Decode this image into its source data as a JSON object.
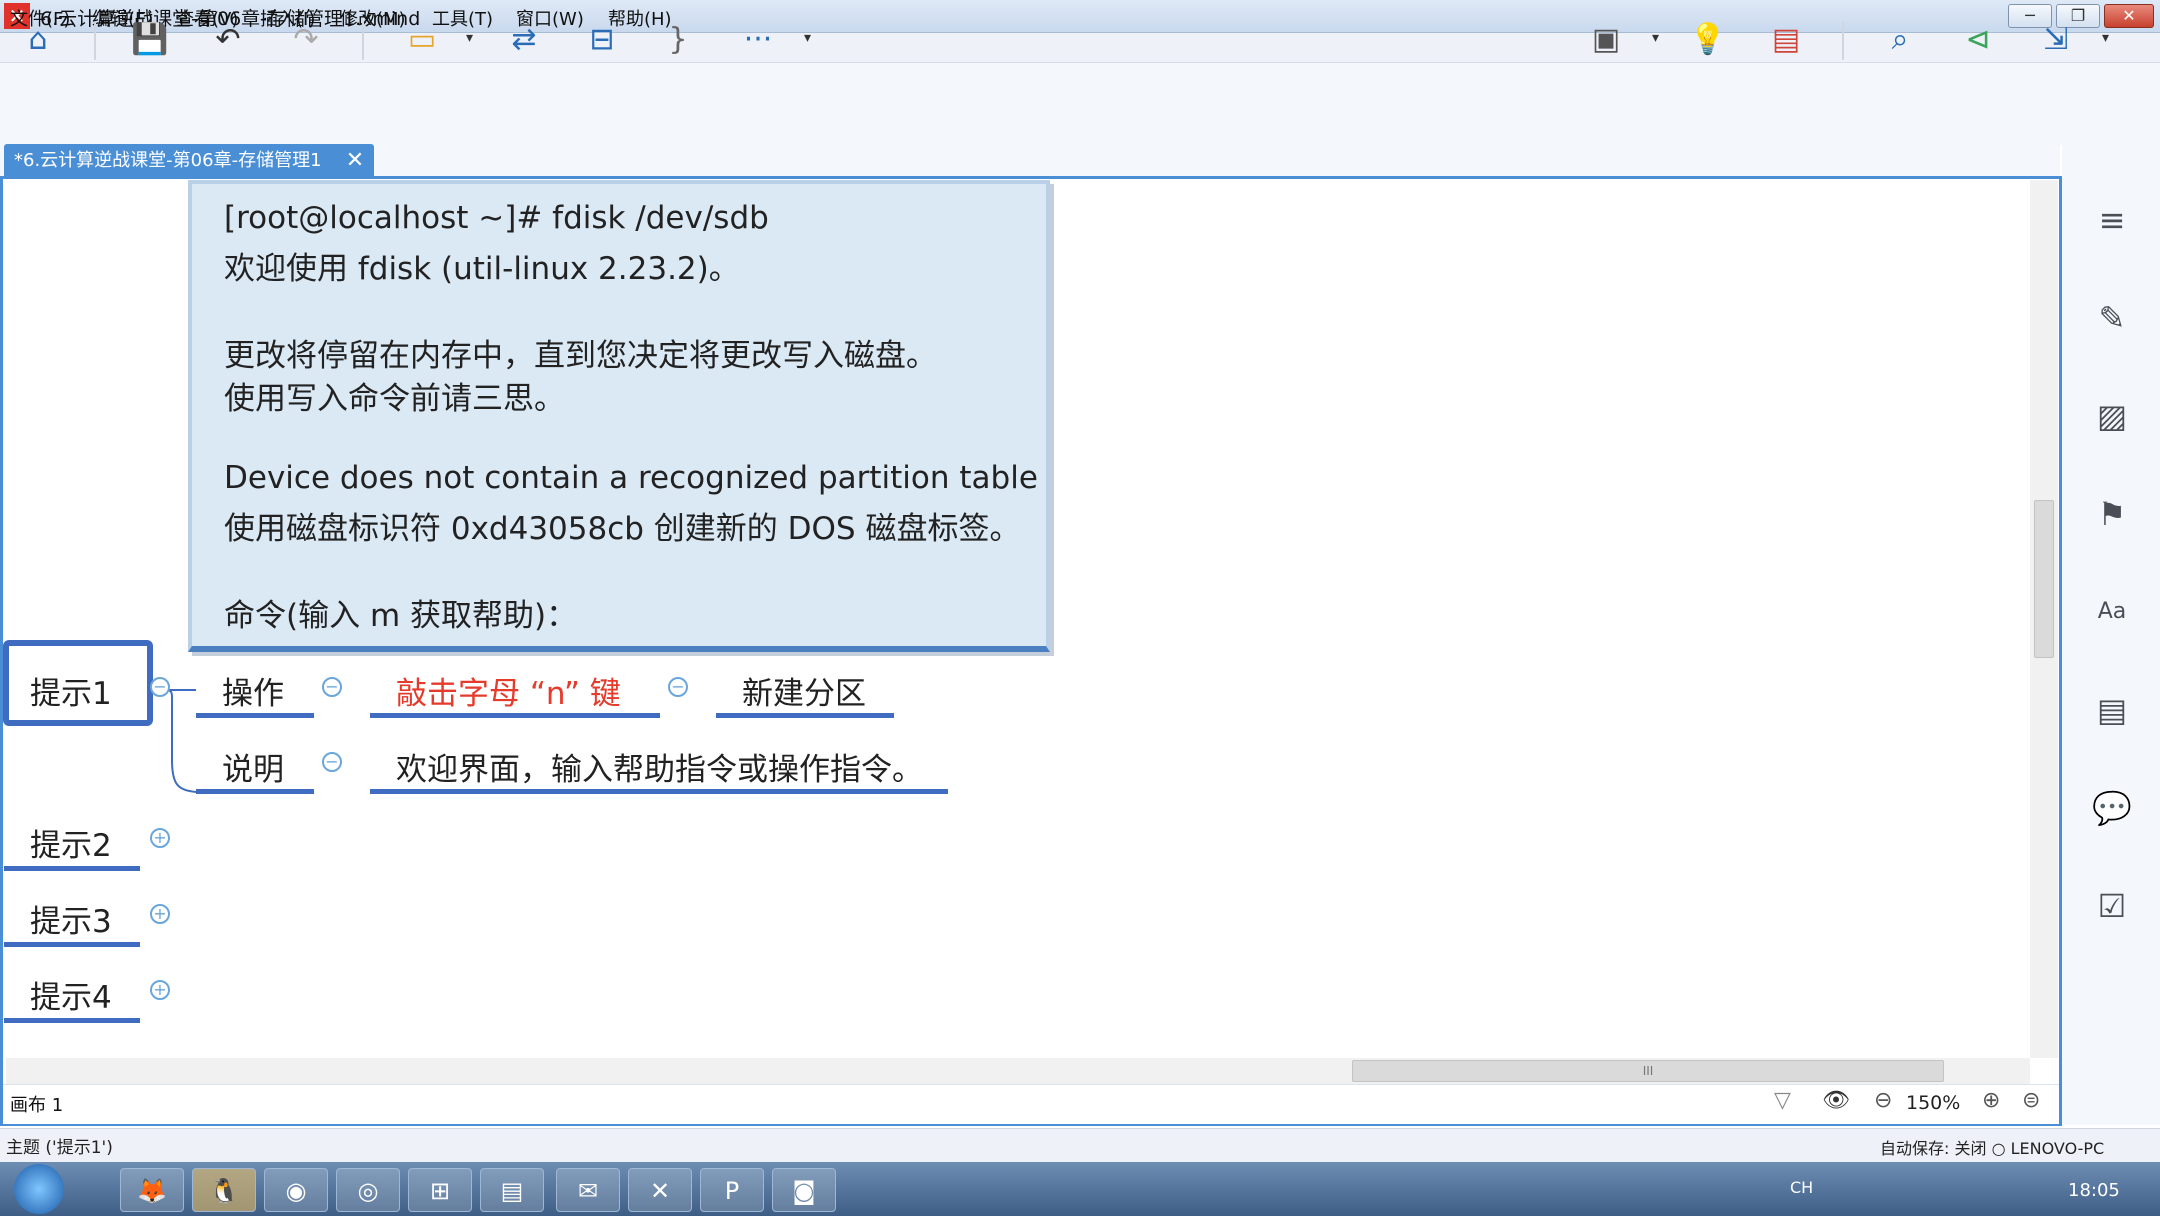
{
  "window": {
    "title": "6.云计算逆战课堂-第06章-存储管理1.xmind",
    "logo": "✕",
    "min": "─",
    "max": "❐",
    "close": "✕"
  },
  "menu": [
    "文件(F)",
    "编辑(E)",
    "查看(V)",
    "插入(I)",
    "修改(M)",
    "工具(T)",
    "窗口(W)",
    "帮助(H)"
  ],
  "toolbar": {
    "home_icon": "⌂",
    "save_icon": "💾",
    "undo_icon": "↶",
    "redo_icon": "↷",
    "topic_icon": "▭",
    "relationship_icon": "⇄",
    "boundary_icon": "⊟",
    "summary_icon": "}",
    "more_icon": "···",
    "caret": "▾",
    "present_icon": "▣",
    "idea_icon": "💡",
    "gantt_icon": "▤",
    "search_icon": "⌕",
    "share_icon": "⊲",
    "export_icon": "⇲"
  },
  "tab": {
    "label": "*6.云计算逆战课堂-第06章-存储管理1",
    "close": "✕"
  },
  "note": {
    "lines": [
      "[root@localhost ~]# fdisk /dev/sdb",
      "欢迎使用 fdisk (util-linux 2.23.2)。",
      "更改将停留在内存中，直到您决定将更改写入磁盘。",
      "使用写入命令前请三思。",
      "Device does not contain a recognized partition table",
      "使用磁盘标识符 0xd43058cb 创建新的 DOS 磁盘标签。",
      "命令(输入 m 获取帮助)："
    ]
  },
  "mindmap": {
    "topic1": "提示1",
    "branch1_label": "操作",
    "branch1_action": "敲击字母 “n” 键",
    "branch1_result": "新建分区",
    "branch2_label": "说明",
    "branch2_text": "欢迎界面，输入帮助指令或操作指令。",
    "topic2": "提示2",
    "topic3": "提示3",
    "topic4": "提示4",
    "collapse": "−",
    "expand": "+",
    "accent": "#e53b2c"
  },
  "canvas": {
    "sheet": "画布 1",
    "zoom": "150%",
    "zoom_out": "⊖",
    "zoom_in": "⊕",
    "filter_icon": "▽",
    "eye_icon": "👁",
    "fit_icon": "⊜",
    "hthumb_label": "III"
  },
  "sidebar_icons": [
    "≡",
    "✎",
    "▨",
    "⚑",
    "Aa",
    "▤",
    "💬",
    "☑"
  ],
  "statusbar": {
    "left": "主题 ('提示1')",
    "right": "自动保存: 关闭  ○ LENOVO-PC"
  },
  "taskbar": {
    "lang": "CH",
    "time": "18:05",
    "apps": [
      "🦊",
      "🐧",
      "◉",
      "◎",
      "⊞",
      "▤",
      "✉",
      "✕",
      "P",
      "◙"
    ]
  }
}
